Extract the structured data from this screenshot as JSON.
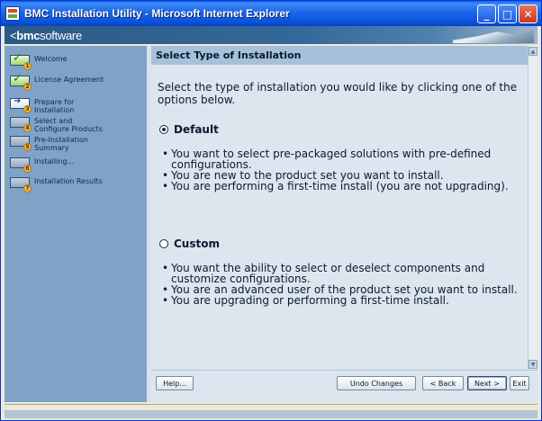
{
  "window": {
    "title": "BMC Installation Utility - Microsoft Internet Explorer",
    "controls": {
      "minimize": "_",
      "maximize": "□",
      "close": "✕"
    }
  },
  "brand": {
    "logo_prefix": "<",
    "logo_bold": "bmc",
    "logo_rest": "software"
  },
  "sidebar": {
    "steps": [
      {
        "num": "1",
        "label": "Welcome",
        "state": "done"
      },
      {
        "num": "2",
        "label": "License Agreement",
        "state": "done"
      },
      {
        "num": "3",
        "label": "Prepare for\nInstallation",
        "state": "current"
      },
      {
        "num": "4",
        "label": "Select and\nConfigure Products",
        "state": "todo"
      },
      {
        "num": "5",
        "label": "Pre-Installation\nSummary",
        "state": "todo"
      },
      {
        "num": "6",
        "label": "Installing...",
        "state": "todo"
      },
      {
        "num": "7",
        "label": "Installation Results",
        "state": "todo"
      }
    ]
  },
  "content": {
    "title": "Select Type of Installation",
    "intro": "Select the type of installation you would like by clicking one of the options below.",
    "options": [
      {
        "label": "Default",
        "checked": true,
        "bullets": [
          "You want to select pre-packaged solutions with pre-defined configurations.",
          "You are new to the product set you want to install.",
          "You are performing a first-time install (you are not upgrading)."
        ]
      },
      {
        "label": "Custom",
        "checked": false,
        "bullets": [
          "You want the ability to select or deselect components and customize configurations.",
          "You are an advanced user of the product set you want to install.",
          "You are upgrading or performing a first-time install."
        ]
      }
    ]
  },
  "buttons": {
    "help": "Help...",
    "undo": "Undo Changes",
    "back": "< Back",
    "next": "Next >",
    "exit": "Exit"
  },
  "scrollbar": {
    "up": "▲",
    "down": "▼"
  },
  "colors": {
    "titlebar": "#0B52DA",
    "sidebar": "#7FA2C6",
    "content_header": "#A7C0D9",
    "content_bg": "#DDE6EE"
  }
}
